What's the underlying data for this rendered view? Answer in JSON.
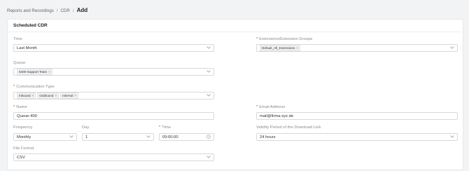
{
  "breadcrumb": {
    "items": [
      "Reports and Recordings",
      "CDR"
    ],
    "separator": "/",
    "current": "Add"
  },
  "section_title": "Scheduled CDR",
  "fields": {
    "time": {
      "label": "Time",
      "value": "Last Month"
    },
    "extensions": {
      "label": "Extensions/Extension Groups",
      "tags": [
        "Default_All_Extensions"
      ]
    },
    "queue": {
      "label": "Queue",
      "tags": [
        "6400-Support Team"
      ]
    },
    "communication_type": {
      "label": "Communication Type",
      "tags": [
        "Inbound",
        "Outbound",
        "Internal"
      ]
    },
    "name": {
      "label": "Name",
      "value": "Queue-400"
    },
    "email": {
      "label": "Email Address",
      "value": "mail@firma-xyz.de"
    },
    "frequency": {
      "label": "Frequency",
      "value": "Monthly"
    },
    "day": {
      "label": "Day",
      "value": "1"
    },
    "send_time": {
      "label": "Time",
      "value": "09:00:00"
    },
    "validity": {
      "label": "Validity Period of the Download Link",
      "value": "24 hours"
    },
    "file_format": {
      "label": "File Format",
      "value": "CSV"
    }
  },
  "tag_remove_glyph": "×",
  "required_mark": "*",
  "colors": {
    "required": "#e53935",
    "border": "#d9d9d9",
    "background": "#f2f3f5"
  },
  "icons": {
    "dropdown": "chevron-down-icon",
    "clock": "clock-icon",
    "remove": "close-icon"
  }
}
